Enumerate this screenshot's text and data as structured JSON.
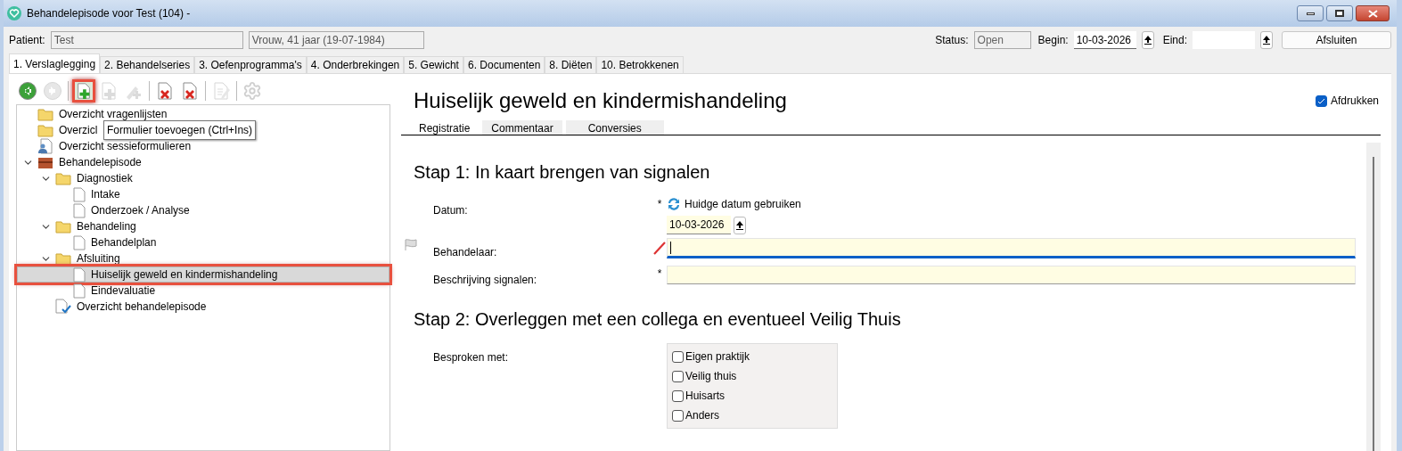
{
  "window": {
    "title": "Behandelepisode voor Test (104) -"
  },
  "patient": {
    "label": "Patient:",
    "name": "Test",
    "info": "Vrouw, 41 jaar (19-07-1984)"
  },
  "status": {
    "label": "Status:",
    "value": "Open"
  },
  "begin": {
    "label": "Begin:",
    "value": "10-03-2026"
  },
  "eind": {
    "label": "Eind:"
  },
  "close_button": "Afsluiten",
  "tabs": [
    {
      "label": "1. Verslaglegging",
      "selected": true
    },
    {
      "label": "2. Behandelseries",
      "selected": false
    },
    {
      "label": "3. Oefenprogramma's",
      "selected": false
    },
    {
      "label": "4. Onderbrekingen",
      "selected": false
    },
    {
      "label": "5. Gewicht",
      "selected": false
    },
    {
      "label": "6. Documenten",
      "selected": false
    },
    {
      "label": "8. Diëten",
      "selected": false
    },
    {
      "label": "10. Betrokkenen",
      "selected": false
    }
  ],
  "toolbar": [
    {
      "kind": "back",
      "disabled": false,
      "highlighted": false
    },
    {
      "kind": "forward",
      "disabled": true,
      "highlighted": false
    },
    {
      "kind": "add",
      "disabled": false,
      "highlighted": true
    },
    {
      "kind": "add",
      "disabled": true,
      "highlighted": false
    },
    {
      "kind": "add-tool",
      "disabled": true,
      "highlighted": false
    },
    {
      "kind": "delete",
      "disabled": false,
      "highlighted": false
    },
    {
      "kind": "delete-small",
      "disabled": false,
      "highlighted": false
    },
    {
      "kind": "edit",
      "disabled": true,
      "highlighted": false
    },
    {
      "kind": "settings",
      "disabled": true,
      "highlighted": false
    }
  ],
  "tooltip": "Formulier toevoegen (Ctrl+Ins)",
  "tree": [
    {
      "label": "Overzicht vragenlijsten",
      "kind": "folder",
      "selected": false,
      "highlighted": false
    },
    {
      "label": "Overzicl",
      "kind": "folder",
      "selected": false,
      "highlighted": false
    },
    {
      "label": "Overzicht sessieformulieren",
      "kind": "people",
      "selected": false,
      "highlighted": false
    },
    {
      "label": "Behandelepisode",
      "kind": "episode",
      "selected": false,
      "highlighted": false,
      "expanded": true,
      "children": [
        {
          "label": "Diagnostiek",
          "kind": "folder",
          "selected": false,
          "highlighted": false,
          "expanded": true,
          "children": [
            {
              "label": "Intake",
              "kind": "document",
              "selected": false,
              "highlighted": false
            },
            {
              "label": "Onderzoek / Analyse",
              "kind": "document",
              "selected": false,
              "highlighted": false
            }
          ]
        },
        {
          "label": "Behandeling",
          "kind": "folder",
          "selected": false,
          "highlighted": false,
          "expanded": true,
          "children": [
            {
              "label": "Behandelplan",
              "kind": "document",
              "selected": false,
              "highlighted": false
            }
          ]
        },
        {
          "label": "Afsluiting",
          "kind": "folder",
          "selected": false,
          "highlighted": false,
          "expanded": true,
          "children": [
            {
              "label": "Huiselijk geweld en kindermishandeling",
              "kind": "document",
              "selected": true,
              "highlighted": true
            },
            {
              "label": "Eindevaluatie",
              "kind": "document",
              "selected": false,
              "highlighted": false
            }
          ]
        },
        {
          "label": "Overzicht behandelepisode",
          "kind": "report",
          "selected": false,
          "highlighted": false
        }
      ]
    }
  ],
  "form": {
    "title": "Huiselijk geweld en kindermishandeling",
    "print_checkbox": {
      "label": "Afdrukken",
      "checked": true
    },
    "subtabs": [
      {
        "label": "Registratie",
        "selected": true
      },
      {
        "label": "Commentaar",
        "selected": false
      },
      {
        "label": "Conversies",
        "selected": false
      }
    ],
    "sections": [
      {
        "heading": "Stap 1: In kaart brengen van signalen",
        "fields": [
          {
            "kind": "date",
            "label": "Datum:",
            "required_mark": "*",
            "link": "Huidge datum gebruiken",
            "value": "10-03-2026"
          },
          {
            "kind": "text",
            "label": "Behandelaar:",
            "flagged": true,
            "editing": true,
            "focused": true
          },
          {
            "kind": "text",
            "label": "Beschrijving signalen:",
            "required_mark": "*",
            "focused": false
          }
        ]
      },
      {
        "heading": "Stap 2: Overleggen met een collega en eventueel Veilig Thuis",
        "fields": [
          {
            "kind": "checkbox_group",
            "label": "Besproken met:",
            "options": [
              {
                "label": "Eigen praktijk",
                "checked": false
              },
              {
                "label": "Veilig thuis",
                "checked": false
              },
              {
                "label": "Huisarts",
                "checked": false
              },
              {
                "label": "Anders",
                "checked": false
              }
            ]
          }
        ]
      }
    ]
  }
}
